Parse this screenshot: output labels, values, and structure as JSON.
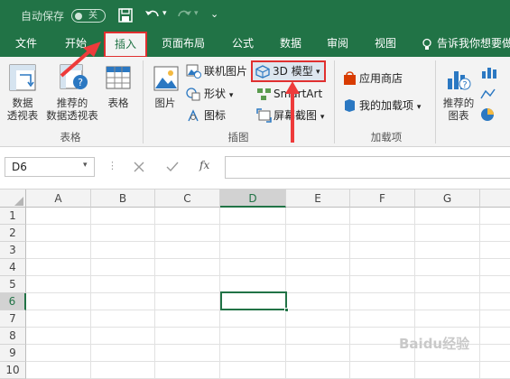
{
  "titlebar": {
    "autosave_label": "自动保存",
    "autosave_state": "关"
  },
  "tabs": [
    {
      "label": "文件"
    },
    {
      "label": "开始"
    },
    {
      "label": "插入"
    },
    {
      "label": "页面布局"
    },
    {
      "label": "公式"
    },
    {
      "label": "数据"
    },
    {
      "label": "审阅"
    },
    {
      "label": "视图"
    }
  ],
  "tellme": {
    "label": "告诉我你想要做"
  },
  "ribbon": {
    "tables": {
      "pivot": "数据\n透视表",
      "recommended_pivot": "推荐的\n数据透视表",
      "table": "表格",
      "group_label": "表格"
    },
    "illustrations": {
      "pictures": "图片",
      "online_pictures": "联机图片",
      "shapes": "形状",
      "icons": "图标",
      "model3d": "3D 模型",
      "smartart": "SmartArt",
      "screenshot": "屏幕截图",
      "group_label": "插图"
    },
    "addins": {
      "store": "应用商店",
      "my_addins": "我的加载项",
      "group_label": "加载项"
    },
    "charts": {
      "recommended": "推荐的\n图表"
    }
  },
  "formula_bar": {
    "name_box": "D6",
    "fx": "fx",
    "formula": ""
  },
  "sheet": {
    "columns": [
      "A",
      "B",
      "C",
      "D",
      "E",
      "F",
      "G"
    ],
    "rows": [
      "1",
      "2",
      "3",
      "4",
      "5",
      "6",
      "7",
      "8",
      "9",
      "10"
    ],
    "active_cell": "D6"
  },
  "watermark": "Baidu经验",
  "colors": {
    "excel_green": "#217346",
    "highlight_red": "#e03030"
  }
}
